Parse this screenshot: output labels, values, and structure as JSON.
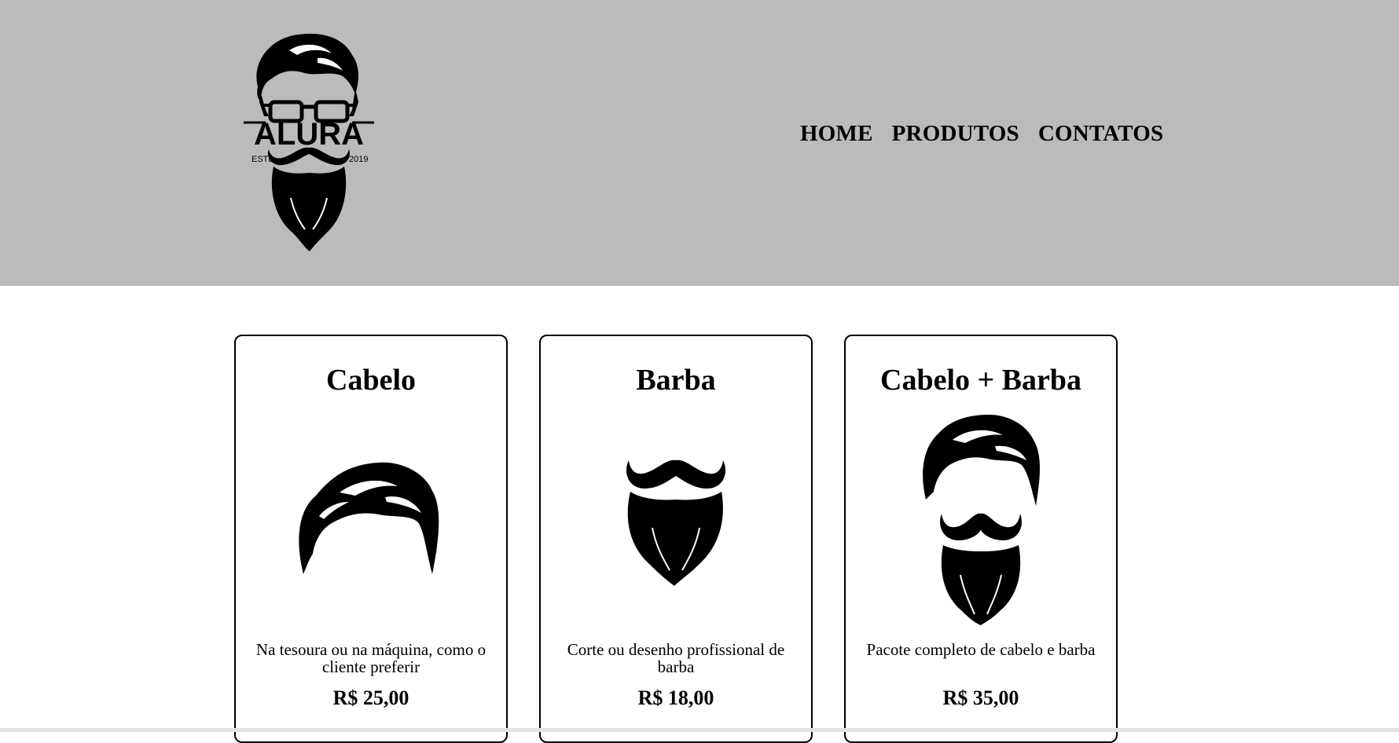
{
  "header": {
    "logo": {
      "brand": "ALURA",
      "left_text": "ESTD",
      "right_text": "2019",
      "icon": "bearded-man-glasses-logo"
    },
    "nav": {
      "home": "HOME",
      "produtos": "PRODUTOS",
      "contatos": "CONTATOS"
    }
  },
  "products": [
    {
      "title": "Cabelo",
      "icon": "hair-icon",
      "description": "Na tesoura ou na máquina, como o cliente preferir",
      "price": "R$ 25,00"
    },
    {
      "title": "Barba",
      "icon": "beard-icon",
      "description": "Corte ou desenho profissional de barba",
      "price": "R$ 18,00"
    },
    {
      "title": "Cabelo + Barba",
      "icon": "hair-and-beard-icon",
      "description": "Pacote completo de cabelo e barba",
      "price": "R$ 35,00"
    }
  ],
  "colors": {
    "header_background": "#bbbbbb",
    "page_background": "#ffffff",
    "text": "#000000"
  }
}
